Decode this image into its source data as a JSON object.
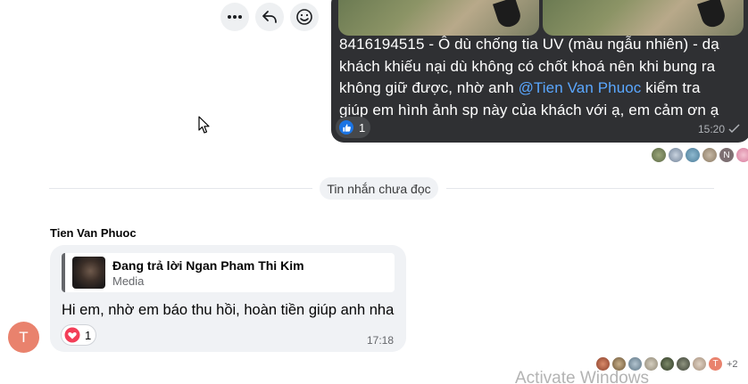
{
  "message_actions": {
    "more_icon": "ellipsis-icon",
    "reply_icon": "reply-arrow-icon",
    "react_icon": "smiley-icon"
  },
  "outgoing_message": {
    "text_prefix": "8416194515 - Ô dù chống tia UV (màu ngẫu nhiên)   - dạ khách khiếu nại dù không có chốt khoá nên khi bung ra không giữ được, nhờ anh ",
    "mention": "@Tien Van Phuoc",
    "text_suffix": " kiểm tra giúp em hình ảnh sp này của khách với ạ, em cảm ơn ạ",
    "reaction_count": "1",
    "time": "15:20",
    "bubble_color": "#2f3033",
    "mention_color": "#5aa7ff"
  },
  "read_receipts": {
    "letter_avatar": "N"
  },
  "unread_divider": {
    "label": "Tin nhắn chưa đọc"
  },
  "incoming_message": {
    "sender": "Tien Van Phuoc",
    "sender_initial": "T",
    "reply_title": "Đang trả lời Ngan Pham Thi Kim",
    "reply_subtitle": "Media",
    "text": "Hi em, nhờ em báo thu hồi, hoàn tiền giúp anh nha",
    "reaction_count": "1",
    "time": "17:18"
  },
  "bottom_read_receipts": {
    "letter_avatar": "T",
    "more": "+2"
  },
  "watermark": "Activate Windows"
}
